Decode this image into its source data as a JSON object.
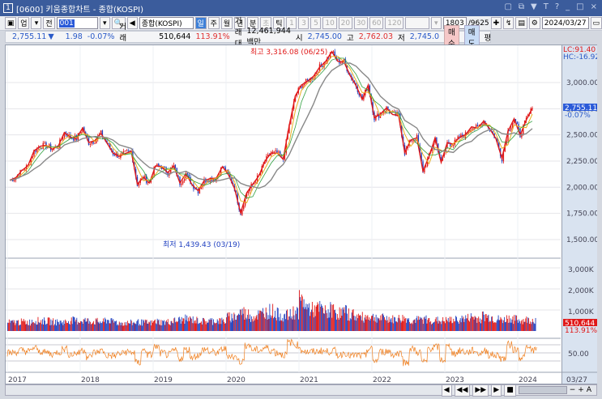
{
  "window": {
    "number": "1",
    "title": "[0600] 키움종합차트 - 종합(KOSPI)",
    "controls": [
      "restore",
      "new-window",
      "pin",
      "T",
      "?",
      "minimize",
      "maximize",
      "close"
    ]
  },
  "toolbar": {
    "market": "업",
    "prev": "전",
    "code": "001",
    "name": "종합(KOSPI)",
    "periods": [
      "일",
      "주",
      "월",
      "년",
      "분",
      "초",
      "틱"
    ],
    "active_period": "일",
    "intervals": [
      "1",
      "3",
      "5",
      "10",
      "20",
      "30",
      "60",
      "120"
    ],
    "count": "1803",
    "total": "/9625",
    "date": "2024/03/27"
  },
  "info": {
    "price": "2,755.11",
    "arrow": "▼",
    "change": "1.98",
    "change_pct": "-0.07%",
    "volume_label": "거래량",
    "volume": "510,644",
    "volume_pct": "113.91%",
    "amount_label": "거래대금",
    "amount": "12,461,944백만",
    "open_label": "시",
    "open": "2,745.00",
    "high_label": "고",
    "high": "2,762.03",
    "low_label": "저",
    "low": "2,745.0",
    "buy": "매수",
    "sell": "매도",
    "avg": "평"
  },
  "chart_data": {
    "type": "line",
    "x_labels": [
      "2017",
      "2018",
      "2019",
      "2020",
      "2021",
      "2022",
      "2023",
      "2024"
    ],
    "y_ticks": [
      "3,000.00",
      "2,750.00",
      "2,500.00",
      "2,250.00",
      "2,000.00",
      "1,750.00",
      "1,500.00"
    ],
    "y_tick_values": [
      3000,
      2750,
      2500,
      2250,
      2000,
      1750,
      1500
    ],
    "closes_monthly": [
      2067,
      2091,
      2160,
      2205,
      2347,
      2391,
      2402,
      2363,
      2394,
      2523,
      2476,
      2467,
      2566,
      2427,
      2445,
      2515,
      2423,
      2326,
      2295,
      2322,
      2343,
      2029,
      2096,
      2041,
      2204,
      2195,
      2140,
      2203,
      2041,
      2130,
      2024,
      1967,
      2063,
      2083,
      2087,
      2197,
      2119,
      1987,
      1754,
      1947,
      2029,
      2108,
      2249,
      2326,
      2327,
      2267,
      2591,
      2873,
      2976,
      3012,
      3061,
      3147,
      3203,
      3296,
      3202,
      3199,
      3068,
      2970,
      2839,
      2977,
      2663,
      2699,
      2757,
      2695,
      2685,
      2332,
      2451,
      2472,
      2155,
      2293,
      2472,
      2236,
      2425,
      2412,
      2476,
      2501,
      2577,
      2564,
      2632,
      2556,
      2465,
      2277,
      2535,
      2655,
      2497,
      2642,
      2755
    ],
    "volume_monthly_k": [
      400,
      420,
      430,
      420,
      500,
      480,
      470,
      440,
      420,
      430,
      500,
      480,
      500,
      480,
      450,
      430,
      520,
      440,
      380,
      380,
      390,
      420,
      400,
      380,
      450,
      420,
      430,
      480,
      520,
      560,
      540,
      500,
      460,
      480,
      500,
      470,
      650,
      700,
      900,
      800,
      700,
      780,
      900,
      950,
      800,
      700,
      750,
      900,
      1400,
      1100,
      1000,
      1050,
      900,
      1000,
      850,
      900,
      800,
      700,
      650,
      700,
      650,
      600,
      600,
      550,
      580,
      600,
      500,
      520,
      550,
      520,
      500,
      480,
      500,
      520,
      560,
      600,
      650,
      600,
      700,
      650,
      550,
      520,
      600,
      550,
      500,
      520,
      510
    ],
    "oscillator_ticks": [
      "50.00"
    ],
    "annotations": {
      "high": "최고 3,316.08 (06/25)",
      "low": "최저 1,439.43 (03/19)",
      "lc": "LC:91.40",
      "hc": "HC:-16.92",
      "last_price": "2,755.11",
      "last_pct": "-0.07%",
      "volume_ticks": [
        "3,000K",
        "2,000K",
        "1,000K"
      ],
      "last_volume": "510,644",
      "last_volume_pct": "113.91%",
      "last_date": "03/27"
    },
    "colors": {
      "candle_up": "#e01818",
      "candle_down": "#2040c0",
      "ma5": "#e01818",
      "ma20": "#e8b020",
      "ma60": "#30a040",
      "ma120": "#888888",
      "osc": "#f08020"
    }
  },
  "bottom_controls": [
    "◀",
    "◀◀",
    "▶▶",
    "▶",
    "■",
    "zoom-out",
    "zoom-in",
    "A"
  ]
}
